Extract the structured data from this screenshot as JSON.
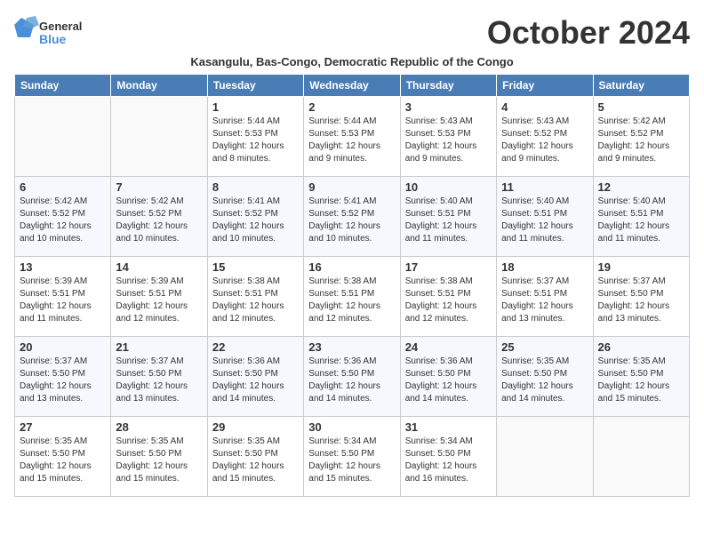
{
  "header": {
    "logo_general": "General",
    "logo_blue": "Blue",
    "month_title": "October 2024",
    "subtitle": "Kasangulu, Bas-Congo, Democratic Republic of the Congo"
  },
  "days_of_week": [
    "Sunday",
    "Monday",
    "Tuesday",
    "Wednesday",
    "Thursday",
    "Friday",
    "Saturday"
  ],
  "weeks": [
    [
      {
        "day": "",
        "sunrise": "",
        "sunset": "",
        "daylight": ""
      },
      {
        "day": "",
        "sunrise": "",
        "sunset": "",
        "daylight": ""
      },
      {
        "day": "1",
        "sunrise": "Sunrise: 5:44 AM",
        "sunset": "Sunset: 5:53 PM",
        "daylight": "Daylight: 12 hours and 8 minutes."
      },
      {
        "day": "2",
        "sunrise": "Sunrise: 5:44 AM",
        "sunset": "Sunset: 5:53 PM",
        "daylight": "Daylight: 12 hours and 9 minutes."
      },
      {
        "day": "3",
        "sunrise": "Sunrise: 5:43 AM",
        "sunset": "Sunset: 5:53 PM",
        "daylight": "Daylight: 12 hours and 9 minutes."
      },
      {
        "day": "4",
        "sunrise": "Sunrise: 5:43 AM",
        "sunset": "Sunset: 5:52 PM",
        "daylight": "Daylight: 12 hours and 9 minutes."
      },
      {
        "day": "5",
        "sunrise": "Sunrise: 5:42 AM",
        "sunset": "Sunset: 5:52 PM",
        "daylight": "Daylight: 12 hours and 9 minutes."
      }
    ],
    [
      {
        "day": "6",
        "sunrise": "Sunrise: 5:42 AM",
        "sunset": "Sunset: 5:52 PM",
        "daylight": "Daylight: 12 hours and 10 minutes."
      },
      {
        "day": "7",
        "sunrise": "Sunrise: 5:42 AM",
        "sunset": "Sunset: 5:52 PM",
        "daylight": "Daylight: 12 hours and 10 minutes."
      },
      {
        "day": "8",
        "sunrise": "Sunrise: 5:41 AM",
        "sunset": "Sunset: 5:52 PM",
        "daylight": "Daylight: 12 hours and 10 minutes."
      },
      {
        "day": "9",
        "sunrise": "Sunrise: 5:41 AM",
        "sunset": "Sunset: 5:52 PM",
        "daylight": "Daylight: 12 hours and 10 minutes."
      },
      {
        "day": "10",
        "sunrise": "Sunrise: 5:40 AM",
        "sunset": "Sunset: 5:51 PM",
        "daylight": "Daylight: 12 hours and 11 minutes."
      },
      {
        "day": "11",
        "sunrise": "Sunrise: 5:40 AM",
        "sunset": "Sunset: 5:51 PM",
        "daylight": "Daylight: 12 hours and 11 minutes."
      },
      {
        "day": "12",
        "sunrise": "Sunrise: 5:40 AM",
        "sunset": "Sunset: 5:51 PM",
        "daylight": "Daylight: 12 hours and 11 minutes."
      }
    ],
    [
      {
        "day": "13",
        "sunrise": "Sunrise: 5:39 AM",
        "sunset": "Sunset: 5:51 PM",
        "daylight": "Daylight: 12 hours and 11 minutes."
      },
      {
        "day": "14",
        "sunrise": "Sunrise: 5:39 AM",
        "sunset": "Sunset: 5:51 PM",
        "daylight": "Daylight: 12 hours and 12 minutes."
      },
      {
        "day": "15",
        "sunrise": "Sunrise: 5:38 AM",
        "sunset": "Sunset: 5:51 PM",
        "daylight": "Daylight: 12 hours and 12 minutes."
      },
      {
        "day": "16",
        "sunrise": "Sunrise: 5:38 AM",
        "sunset": "Sunset: 5:51 PM",
        "daylight": "Daylight: 12 hours and 12 minutes."
      },
      {
        "day": "17",
        "sunrise": "Sunrise: 5:38 AM",
        "sunset": "Sunset: 5:51 PM",
        "daylight": "Daylight: 12 hours and 12 minutes."
      },
      {
        "day": "18",
        "sunrise": "Sunrise: 5:37 AM",
        "sunset": "Sunset: 5:51 PM",
        "daylight": "Daylight: 12 hours and 13 minutes."
      },
      {
        "day": "19",
        "sunrise": "Sunrise: 5:37 AM",
        "sunset": "Sunset: 5:50 PM",
        "daylight": "Daylight: 12 hours and 13 minutes."
      }
    ],
    [
      {
        "day": "20",
        "sunrise": "Sunrise: 5:37 AM",
        "sunset": "Sunset: 5:50 PM",
        "daylight": "Daylight: 12 hours and 13 minutes."
      },
      {
        "day": "21",
        "sunrise": "Sunrise: 5:37 AM",
        "sunset": "Sunset: 5:50 PM",
        "daylight": "Daylight: 12 hours and 13 minutes."
      },
      {
        "day": "22",
        "sunrise": "Sunrise: 5:36 AM",
        "sunset": "Sunset: 5:50 PM",
        "daylight": "Daylight: 12 hours and 14 minutes."
      },
      {
        "day": "23",
        "sunrise": "Sunrise: 5:36 AM",
        "sunset": "Sunset: 5:50 PM",
        "daylight": "Daylight: 12 hours and 14 minutes."
      },
      {
        "day": "24",
        "sunrise": "Sunrise: 5:36 AM",
        "sunset": "Sunset: 5:50 PM",
        "daylight": "Daylight: 12 hours and 14 minutes."
      },
      {
        "day": "25",
        "sunrise": "Sunrise: 5:35 AM",
        "sunset": "Sunset: 5:50 PM",
        "daylight": "Daylight: 12 hours and 14 minutes."
      },
      {
        "day": "26",
        "sunrise": "Sunrise: 5:35 AM",
        "sunset": "Sunset: 5:50 PM",
        "daylight": "Daylight: 12 hours and 15 minutes."
      }
    ],
    [
      {
        "day": "27",
        "sunrise": "Sunrise: 5:35 AM",
        "sunset": "Sunset: 5:50 PM",
        "daylight": "Daylight: 12 hours and 15 minutes."
      },
      {
        "day": "28",
        "sunrise": "Sunrise: 5:35 AM",
        "sunset": "Sunset: 5:50 PM",
        "daylight": "Daylight: 12 hours and 15 minutes."
      },
      {
        "day": "29",
        "sunrise": "Sunrise: 5:35 AM",
        "sunset": "Sunset: 5:50 PM",
        "daylight": "Daylight: 12 hours and 15 minutes."
      },
      {
        "day": "30",
        "sunrise": "Sunrise: 5:34 AM",
        "sunset": "Sunset: 5:50 PM",
        "daylight": "Daylight: 12 hours and 15 minutes."
      },
      {
        "day": "31",
        "sunrise": "Sunrise: 5:34 AM",
        "sunset": "Sunset: 5:50 PM",
        "daylight": "Daylight: 12 hours and 16 minutes."
      },
      {
        "day": "",
        "sunrise": "",
        "sunset": "",
        "daylight": ""
      },
      {
        "day": "",
        "sunrise": "",
        "sunset": "",
        "daylight": ""
      }
    ]
  ]
}
